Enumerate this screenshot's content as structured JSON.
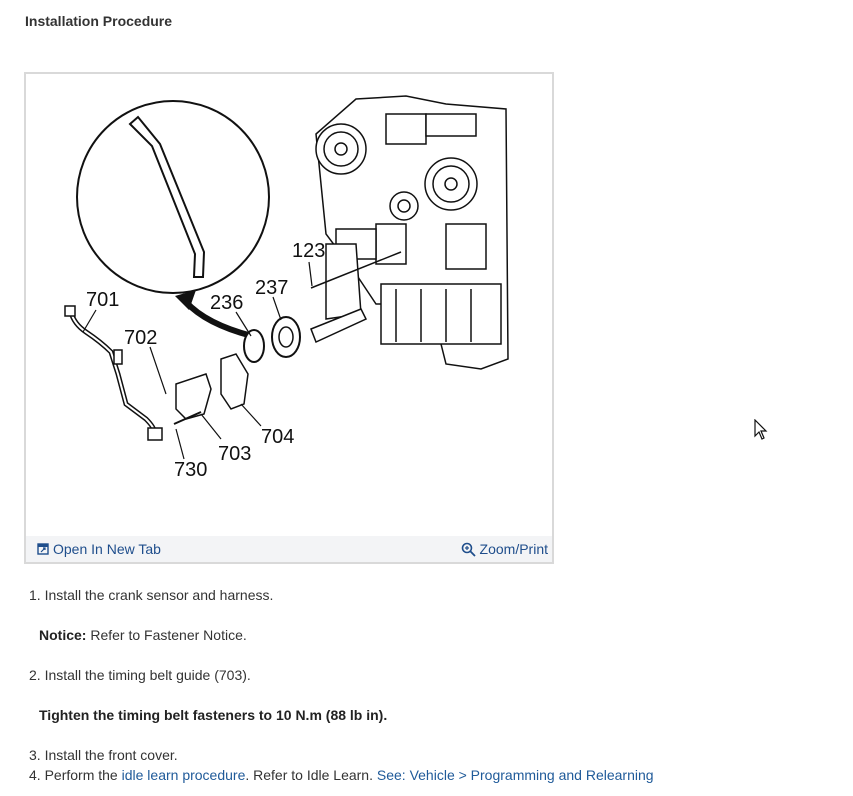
{
  "section": {
    "title": "Installation Procedure"
  },
  "figure": {
    "callouts": [
      "701",
      "702",
      "236",
      "237",
      "123",
      "704",
      "703",
      "730"
    ],
    "toolbar": {
      "open_label": "Open In New Tab",
      "zoom_label": "Zoom/Print",
      "icons": {
        "open": "open-new-tab-icon",
        "zoom": "zoom-icon"
      }
    }
  },
  "steps": {
    "step1": {
      "num": "1. ",
      "text": "Install the crank sensor and harness."
    },
    "notice": {
      "label": "Notice:",
      "text": " Refer to Fastener Notice."
    },
    "step2": {
      "num": "2. ",
      "text": "Install the timing belt guide (703)."
    },
    "torque": {
      "text": "Tighten the timing belt fasteners to 10 N.m (88 lb in)."
    },
    "step3": {
      "num": "3. ",
      "text": "Install the front cover."
    },
    "step4": {
      "num": "4. ",
      "prefix": "Perform the ",
      "link1": "idle learn procedure",
      "middle": ". Refer to Idle Learn. ",
      "link2": "See: Vehicle > Programming and Relearning"
    }
  },
  "colors": {
    "link": "#1f5a99",
    "toolbar_bg": "#f3f4f6",
    "text": "#333333"
  }
}
